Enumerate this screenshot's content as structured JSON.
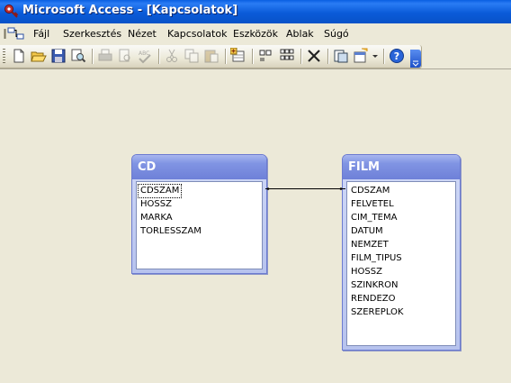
{
  "window": {
    "title": "Microsoft Access - [Kapcsolatok]"
  },
  "menu": {
    "items": [
      {
        "label": "Fájl"
      },
      {
        "label": "Szerkesztés"
      },
      {
        "label": "Nézet"
      },
      {
        "label": "Kapcsolatok"
      },
      {
        "label": "Eszközök"
      },
      {
        "label": "Ablak"
      },
      {
        "label": "Súgó"
      }
    ]
  },
  "toolbar": {
    "buttons": [
      "new-icon",
      "open-icon",
      "save-icon",
      "search-icon",
      "print-icon",
      "print-preview-icon",
      "spelling-icon",
      "cut-icon",
      "copy-icon",
      "paste-icon",
      "show-table-icon",
      "show-direct-icon",
      "show-all-icon",
      "delete-icon",
      "new-object-icon",
      "office-links-icon",
      "help-icon"
    ]
  },
  "relationships": {
    "tables": [
      {
        "name": "CD",
        "fields": [
          "CDSZAM",
          "HOSSZ",
          "MARKA",
          "TORLESSZAM"
        ],
        "selected_field": "CDSZAM"
      },
      {
        "name": "FILM",
        "fields": [
          "CDSZAM",
          "FELVETEL",
          "CIM_TEMA",
          "DATUM",
          "NEMZET",
          "FILM_TIPUS",
          "HOSSZ",
          "SZINKRON",
          "RENDEZO",
          "SZEREPLOK"
        ]
      }
    ],
    "links": [
      {
        "from_table": "CD",
        "from_field": "CDSZAM",
        "to_table": "FILM",
        "to_field": "CDSZAM"
      }
    ]
  },
  "colors": {
    "title_bar": "#0a5bd9",
    "window_header": "#7d8fe0",
    "workspace": "#ece9d8"
  }
}
